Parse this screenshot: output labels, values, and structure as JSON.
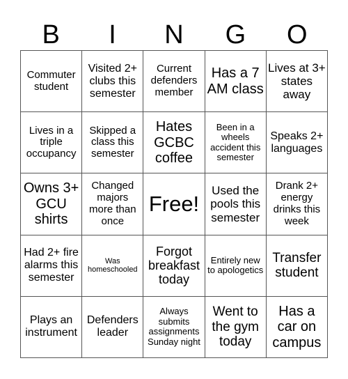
{
  "header": {
    "letters": [
      "B",
      "I",
      "N",
      "G",
      "O"
    ]
  },
  "card": {
    "rows": [
      [
        "Commuter student",
        "Visited 2+ clubs this semester",
        "Current defenders member",
        "Has a 7 AM class",
        "Lives at 3+ states away"
      ],
      [
        "Lives in a triple occupancy",
        "Skipped a class this semester",
        "Hates GCBC coffee",
        "Been in a wheels accident this semester",
        "Speaks 2+ languages"
      ],
      [
        "Owns 3+ GCU shirts",
        "Changed majors more than once",
        "Free!",
        "Used the pools this semester",
        "Drank 2+ energy drinks this week"
      ],
      [
        "Had 2+ fire alarms this semester",
        "Was homeschooled",
        "Forgot breakfast today",
        "Entirely new to apologetics",
        "Transfer student"
      ],
      [
        "Plays an instrument",
        "Defenders leader",
        "Always submits assignments Sunday night",
        "Went to the gym today",
        "Has a car on campus"
      ]
    ],
    "free_space": "Free!"
  }
}
